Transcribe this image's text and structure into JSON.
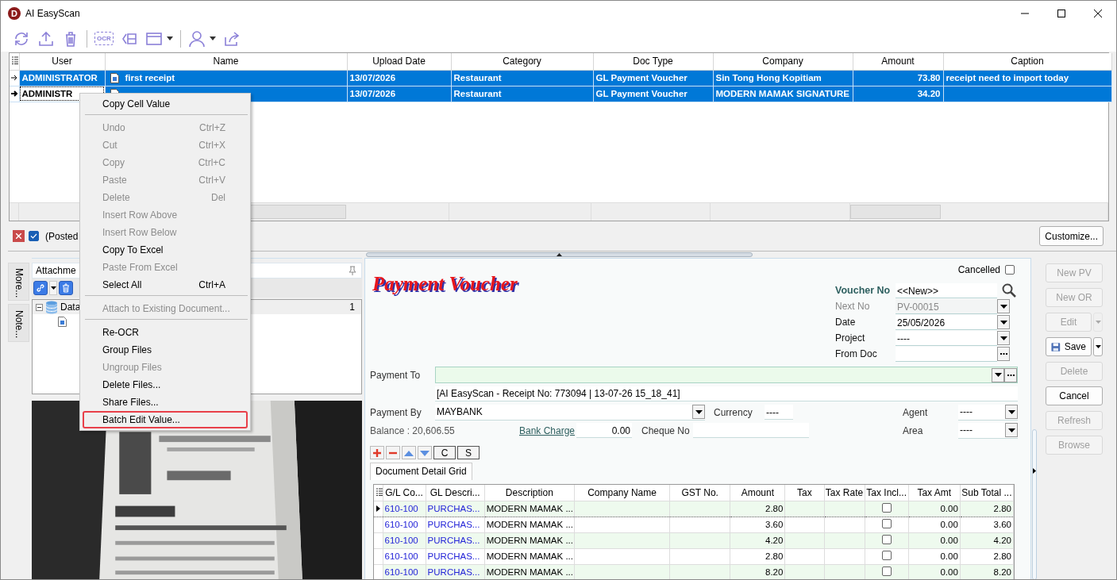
{
  "window": {
    "logo": "D",
    "title": "AI EasyScan"
  },
  "toolbar": [
    {
      "kind": "refresh"
    },
    {
      "kind": "upload"
    },
    {
      "kind": "delete"
    },
    {
      "kind": "separator"
    },
    {
      "kind": "ocr",
      "label": "OCR"
    },
    {
      "kind": "collapse"
    },
    {
      "kind": "layout",
      "dropdown": true
    },
    {
      "kind": "separator"
    },
    {
      "kind": "user",
      "dropdown": true
    },
    {
      "kind": "share"
    }
  ],
  "documents_grid": {
    "columns": [
      "User",
      "Name",
      "Upload Date",
      "Category",
      "Doc Type",
      "Company",
      "Amount",
      "Caption"
    ],
    "rows": [
      {
        "selected": true,
        "current": false,
        "user": "ADMINISTRATOR",
        "name": "first receipt",
        "upload_date": "13/07/2026",
        "category": "Restaurant",
        "doc_type": "GL Payment Voucher",
        "company": "Sin Tong Hong Kopitiam",
        "amount": "73.80",
        "caption": "receipt need to import today"
      },
      {
        "selected": true,
        "current": true,
        "user": "ADMINISTR",
        "upload_date": "13/07/2026",
        "category": "Restaurant",
        "doc_type": "GL Payment Voucher",
        "company": "MODERN MAMAK SIGNATURE",
        "amount": "34.20"
      }
    ]
  },
  "filter_bar": {
    "label": "(Posted",
    "checked": true,
    "customize_button": "Customize..."
  },
  "side_tabs": [
    "More...",
    "Note..."
  ],
  "attachments": {
    "title": "Attachme",
    "tree": [
      {
        "label": "Data",
        "count": "1",
        "expanded": true,
        "children": [
          {
            "kind": "file"
          }
        ]
      }
    ]
  },
  "voucher": {
    "title": "Payment Voucher",
    "cancelled": {
      "label": "Cancelled",
      "checked": false
    },
    "header_fields": [
      {
        "label": "Voucher No",
        "value": "<<New>>",
        "kind": "search",
        "disabled": false
      },
      {
        "label": "Next No",
        "value": "PV-00015",
        "kind": "dropdown",
        "disabled": true
      },
      {
        "label": "Date",
        "value": "25/05/2026",
        "kind": "dropdown",
        "disabled": false
      },
      {
        "label": "Project",
        "value": "----",
        "kind": "dropdown",
        "disabled": false
      },
      {
        "label": "From Doc",
        "kind": "lookup",
        "disabled": false
      }
    ],
    "payment_to": {
      "label": "Payment To"
    },
    "memo": "[AI EasyScan - Receipt No: 773094 | 13-07-26 15_18_41]",
    "payment_by": {
      "label": "Payment By",
      "value": "MAYBANK"
    },
    "currency": {
      "label": "Currency",
      "value": "----"
    },
    "agent": {
      "label": "Agent",
      "value": "----"
    },
    "balance": "Balance : 20,606.55",
    "bank_charge": {
      "label": "Bank Charge",
      "value": "0.00"
    },
    "cheque_no": {
      "label": "Cheque No"
    },
    "area": {
      "label": "Area",
      "value": "----"
    },
    "detail_toolbar": [
      {
        "kind": "add"
      },
      {
        "kind": "remove"
      },
      {
        "kind": "up"
      },
      {
        "kind": "down"
      },
      {
        "kind": "text",
        "label": "C"
      },
      {
        "kind": "text",
        "label": "S"
      }
    ],
    "detail_tab": "Document Detail Grid",
    "detail_grid": {
      "columns": [
        "G/L Co...",
        "GL Descri...",
        "Description",
        "Company Name",
        "GST No.",
        "Amount",
        "Tax",
        "Tax Rate",
        "Tax Incl...",
        "Tax Amt",
        "Sub Total ..."
      ],
      "rows": [
        {
          "current": true,
          "gl_code": "610-100",
          "gl_description": "PURCHAS...",
          "description": "MODERN MAMAK ...",
          "amount": "2.80",
          "tax_included": false,
          "tax_amount": "0.00",
          "sub_total": "2.80"
        },
        {
          "current": false,
          "gl_code": "610-100",
          "gl_description": "PURCHAS...",
          "description": "MODERN MAMAK ...",
          "amount": "3.60",
          "tax_included": false,
          "tax_amount": "0.00",
          "sub_total": "3.60"
        },
        {
          "current": false,
          "gl_code": "610-100",
          "gl_description": "PURCHAS...",
          "description": "MODERN MAMAK ...",
          "amount": "4.20",
          "tax_included": false,
          "tax_amount": "0.00",
          "sub_total": "4.20"
        },
        {
          "current": false,
          "gl_code": "610-100",
          "gl_description": "PURCHAS...",
          "description": "MODERN MAMAK ...",
          "amount": "2.80",
          "tax_included": false,
          "tax_amount": "0.00",
          "sub_total": "2.80"
        },
        {
          "current": false,
          "gl_code": "610-100",
          "gl_description": "PURCHAS...",
          "description": "MODERN MAMAK ...",
          "amount": "8.20",
          "tax_included": false,
          "tax_amount": "0.00",
          "sub_total": "8.20"
        }
      ]
    }
  },
  "action_buttons": [
    {
      "label": "New PV",
      "disabled": true,
      "dropdown": false,
      "icon": false
    },
    {
      "label": "New OR",
      "disabled": true,
      "dropdown": false,
      "icon": false
    },
    {
      "label": "Edit",
      "disabled": true,
      "dropdown": true,
      "icon": false
    },
    {
      "label": "Save",
      "disabled": false,
      "dropdown": true,
      "icon": true
    },
    {
      "label": "Delete",
      "disabled": true,
      "dropdown": false,
      "icon": false
    },
    {
      "label": "Cancel",
      "disabled": false,
      "dropdown": false,
      "icon": false
    },
    {
      "label": "Refresh",
      "disabled": true,
      "dropdown": false,
      "icon": false
    },
    {
      "label": "Browse",
      "disabled": true,
      "dropdown": false,
      "icon": false
    }
  ],
  "context_menu": {
    "items": [
      {
        "kind": "item",
        "label": "Copy Cell Value",
        "disabled": false,
        "highlighted": false
      },
      {
        "kind": "separator"
      },
      {
        "kind": "item",
        "label": "Undo",
        "shortcut": "Ctrl+Z",
        "disabled": true,
        "highlighted": false
      },
      {
        "kind": "item",
        "label": "Cut",
        "shortcut": "Ctrl+X",
        "disabled": true,
        "highlighted": false
      },
      {
        "kind": "item",
        "label": "Copy",
        "shortcut": "Ctrl+C",
        "disabled": true,
        "highlighted": false
      },
      {
        "kind": "item",
        "label": "Paste",
        "shortcut": "Ctrl+V",
        "disabled": true,
        "highlighted": false
      },
      {
        "kind": "item",
        "label": "Delete",
        "shortcut": "Del",
        "disabled": true,
        "highlighted": false
      },
      {
        "kind": "item",
        "label": "Insert Row Above",
        "disabled": true,
        "highlighted": false
      },
      {
        "kind": "item",
        "label": "Insert Row Below",
        "disabled": true,
        "highlighted": false
      },
      {
        "kind": "item",
        "label": "Copy To Excel",
        "disabled": false,
        "highlighted": false
      },
      {
        "kind": "item",
        "label": "Paste From Excel",
        "disabled": true,
        "highlighted": false
      },
      {
        "kind": "item",
        "label": "Select All",
        "shortcut": "Ctrl+A",
        "disabled": false,
        "highlighted": false
      },
      {
        "kind": "separator"
      },
      {
        "kind": "item",
        "label": "Attach to Existing Document...",
        "disabled": true,
        "highlighted": false
      },
      {
        "kind": "separator"
      },
      {
        "kind": "item",
        "label": "Re-OCR",
        "disabled": false,
        "highlighted": false
      },
      {
        "kind": "item",
        "label": "Group Files",
        "disabled": false,
        "highlighted": false
      },
      {
        "kind": "item",
        "label": "Ungroup Files",
        "disabled": true,
        "highlighted": false
      },
      {
        "kind": "item",
        "label": "Delete Files...",
        "disabled": false,
        "highlighted": false
      },
      {
        "kind": "item",
        "label": "Share Files...",
        "disabled": false,
        "highlighted": false
      },
      {
        "kind": "item",
        "label": "Batch Edit Value...",
        "disabled": false,
        "highlighted": true
      }
    ]
  }
}
